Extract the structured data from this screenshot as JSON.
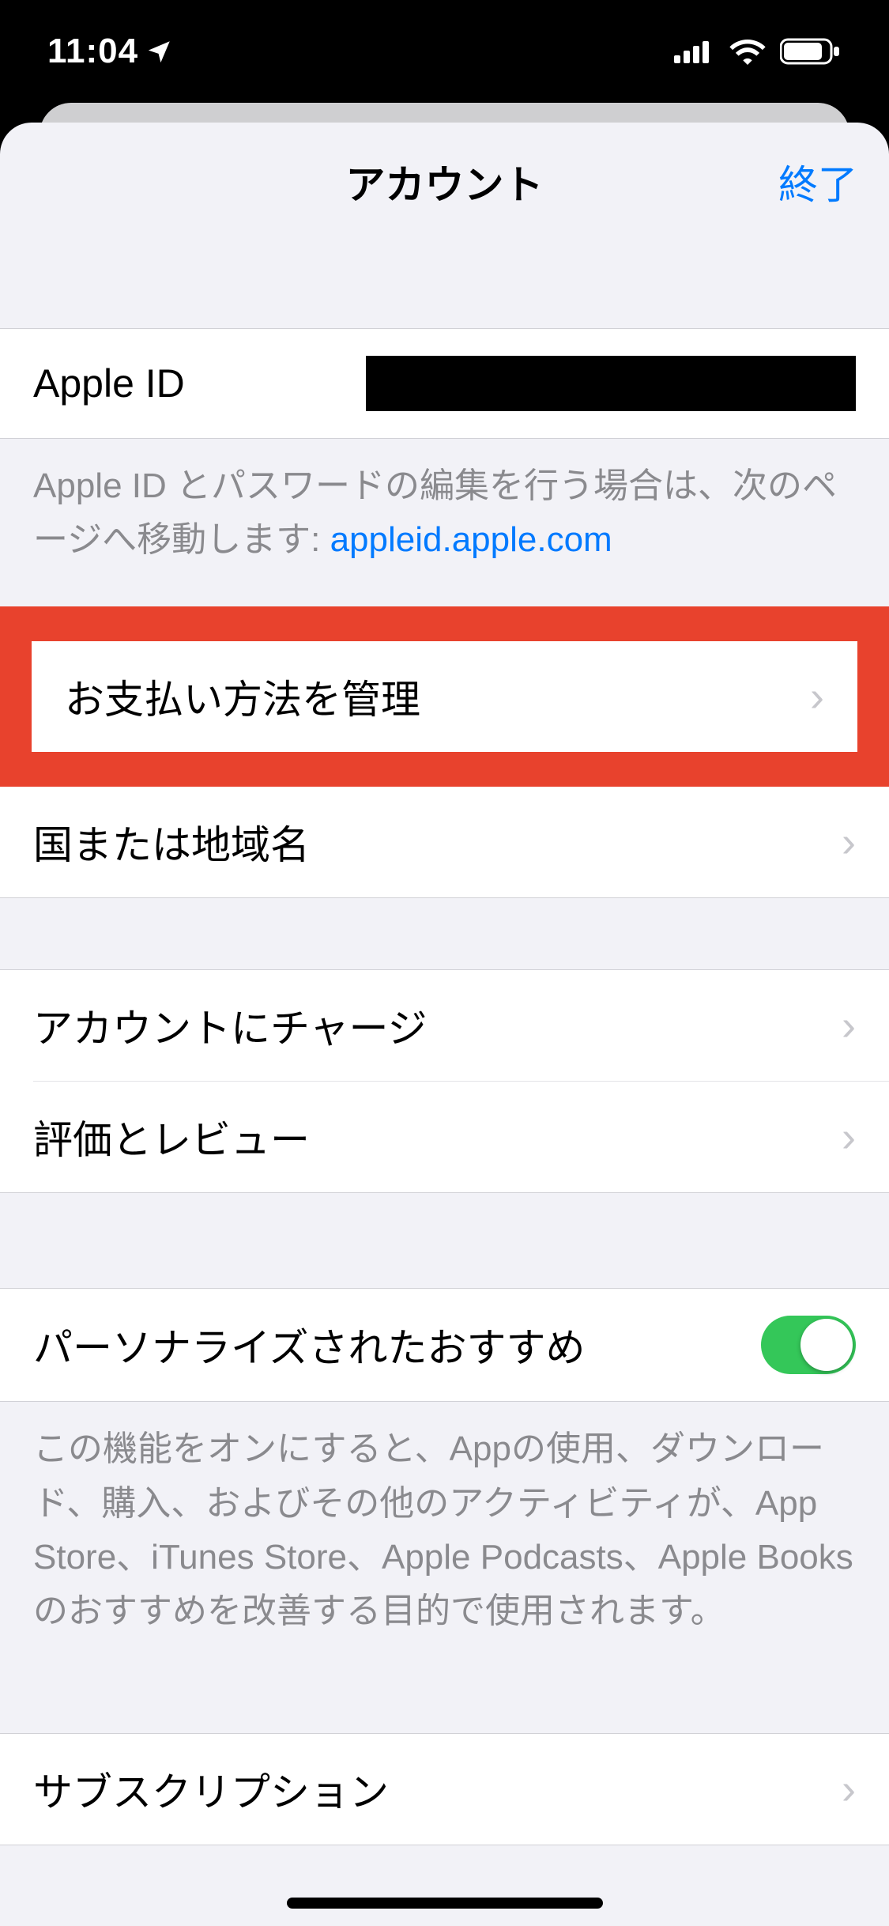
{
  "status": {
    "time": "11:04",
    "location_arrow": "location-arrow-icon",
    "signal": "signal-icon",
    "wifi": "wifi-icon",
    "battery": "battery-icon"
  },
  "nav": {
    "title": "アカウント",
    "done": "終了"
  },
  "apple_id": {
    "label": "Apple ID",
    "footer_pre": "Apple ID とパスワードの編集を行う場合は、次のページへ移動します: ",
    "footer_link": "appleid.apple.com"
  },
  "rows": {
    "manage_payment": "お支払い方法を管理",
    "country_region": "国または地域名",
    "add_funds": "アカウントにチャージ",
    "ratings_reviews": "評価とレビュー",
    "personalized": "パーソナライズされたおすすめ",
    "subscriptions": "サブスクリプション"
  },
  "personalized": {
    "toggle_on": true,
    "footer": "この機能をオンにすると、Appの使用、ダウンロード、購入、およびその他のアクティビティが、App Store、iTunes Store、Apple Podcasts、Apple Books のおすすめを改善する目的で使用されます。"
  }
}
